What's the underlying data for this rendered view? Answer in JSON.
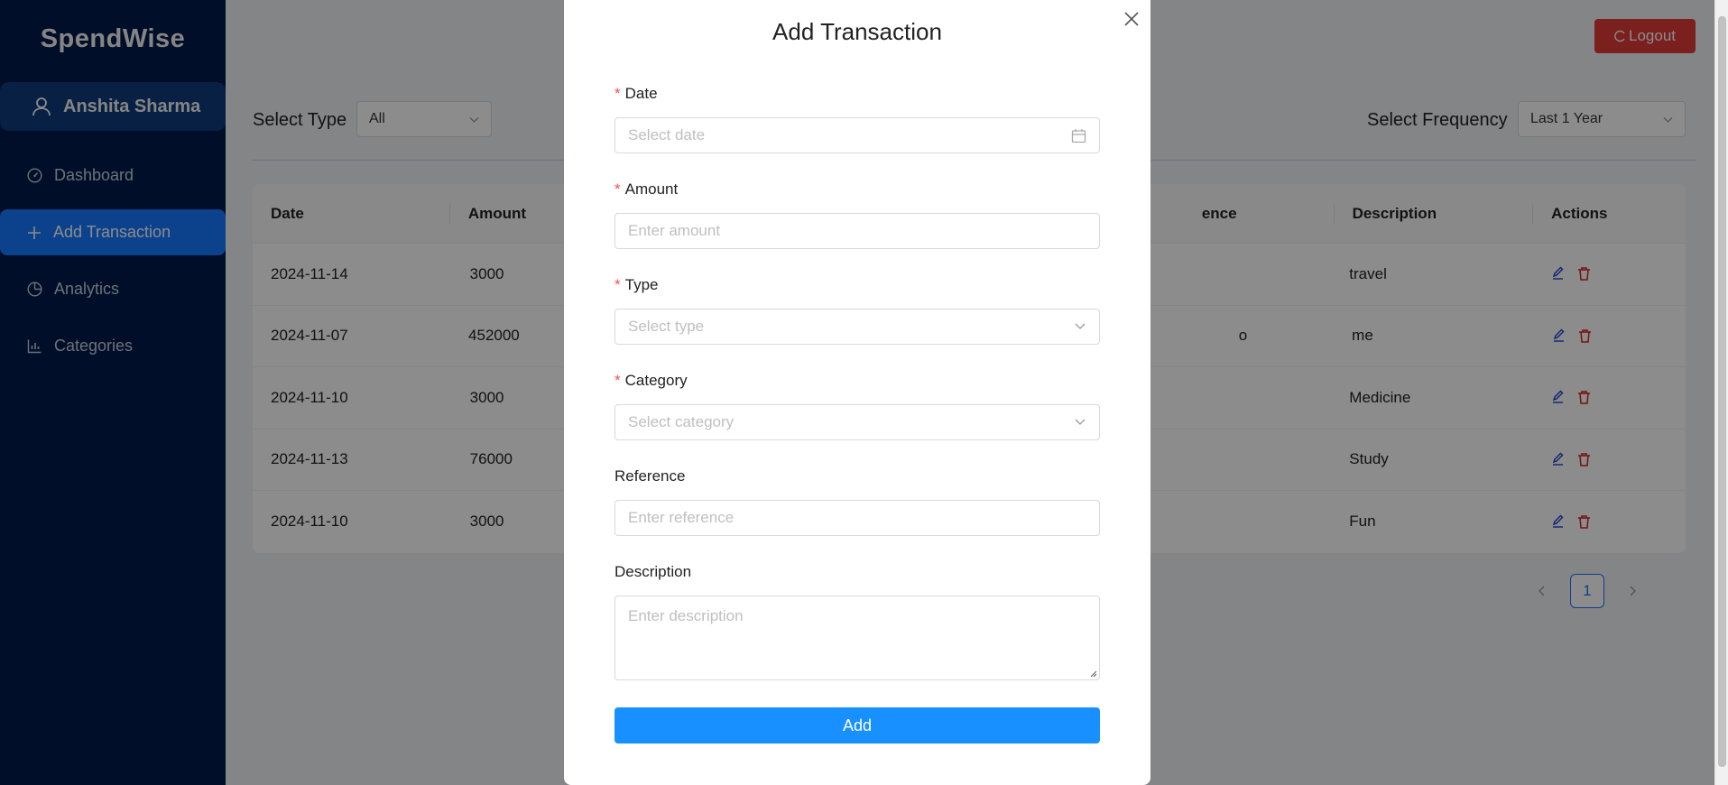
{
  "app": {
    "brand": "SpendWise",
    "user_name": "Anshita Sharma"
  },
  "sidebar": {
    "items": [
      {
        "label": "Dashboard",
        "icon": "dashboard-icon"
      },
      {
        "label": "Add Transaction",
        "icon": "plus-icon",
        "active": true
      },
      {
        "label": "Analytics",
        "icon": "pie-chart-icon"
      },
      {
        "label": "Categories",
        "icon": "bar-chart-icon"
      }
    ]
  },
  "header": {
    "logout_label": "Logout"
  },
  "filters": {
    "type_label": "Select Type",
    "type_value": "All",
    "frequency_label": "Select Frequency",
    "frequency_value": "Last 1 Year"
  },
  "table": {
    "columns": [
      "Date",
      "Amount",
      "",
      "",
      "Reference",
      "Description",
      "Actions"
    ],
    "visible_columns": {
      "date": "Date",
      "amount": "Amount",
      "reference_partial": "ence",
      "description": "Description",
      "actions": "Actions"
    },
    "rows": [
      {
        "date": "2024-11-14",
        "amount": "3000",
        "reference_partial": "",
        "description": "travel"
      },
      {
        "date": "2024-11-07",
        "amount": "452000",
        "reference_partial": "o",
        "description": "me"
      },
      {
        "date": "2024-11-10",
        "amount": "3000",
        "reference_partial": "",
        "description": "Medicine"
      },
      {
        "date": "2024-11-13",
        "amount": "76000",
        "reference_partial": "",
        "description": "Study"
      },
      {
        "date": "2024-11-10",
        "amount": "3000",
        "reference_partial": "",
        "description": "Fun"
      }
    ]
  },
  "pagination": {
    "current_page": "1"
  },
  "modal": {
    "title": "Add Transaction",
    "fields": {
      "date": {
        "label": "Date",
        "placeholder": "Select date",
        "required": true
      },
      "amount": {
        "label": "Amount",
        "placeholder": "Enter amount",
        "required": true
      },
      "type": {
        "label": "Type",
        "placeholder": "Select type",
        "required": true
      },
      "category": {
        "label": "Category",
        "placeholder": "Select category",
        "required": true
      },
      "reference": {
        "label": "Reference",
        "placeholder": "Enter reference",
        "required": false
      },
      "description": {
        "label": "Description",
        "placeholder": "Enter description",
        "required": false
      }
    },
    "submit_label": "Add",
    "required_mark": "*"
  },
  "colors": {
    "sidebar_bg": "#001a4d",
    "accent": "#1677ff",
    "danger": "#e03a3a",
    "required": "#ff4d4f"
  }
}
